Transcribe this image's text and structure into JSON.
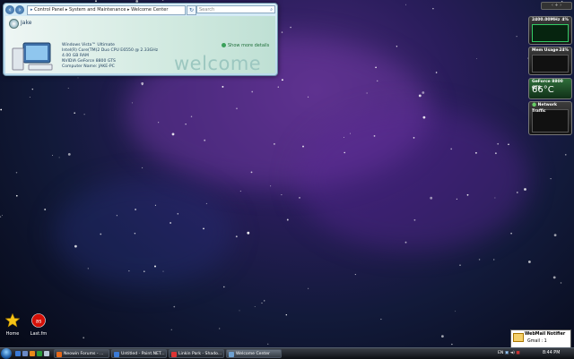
{
  "window": {
    "breadcrumb": [
      "Control Panel",
      "System and Maintenance",
      "Welcome Center"
    ],
    "search_placeholder": "Search",
    "user_name": "Jake",
    "system_info": [
      "Windows Vista™ Ultimate",
      "Intel(R) Core(TM)2 Duo CPU     E6550  @ 2.33GHz",
      "4.00 GB RAM",
      "NVIDIA GeForce 8800 GTS",
      "Computer Name: JAKE-PC"
    ],
    "show_more_label": "Show more details",
    "welcome_word": "welcome"
  },
  "gadgets": {
    "cpu_title": "2400.00MHz",
    "cpu_percent": "4%",
    "mem_title": "Mem Usage",
    "mem_percent": "24%",
    "gpu_title": "GeForce 8800 GTS",
    "gpu_temp": "66°C",
    "net_title": "Network Traffic"
  },
  "desktop_icons": [
    {
      "label": "Home",
      "icon": "star-icon"
    },
    {
      "label": "Last.fm",
      "icon": "lastfm-icon"
    }
  ],
  "notifier": {
    "title": "WebMail Notifier",
    "count": "Gmail : 1"
  },
  "taskbar": {
    "tasks": [
      {
        "label": "Neowin Forums - ...",
        "icon_color": "#e66a1a"
      },
      {
        "label": "Untitled - Paint.NET...",
        "icon_color": "#3a7ad6"
      },
      {
        "label": "Linkin Park - Shado...",
        "icon_color": "#d33"
      },
      {
        "label": "Welcome Center",
        "icon_color": "#6fa1d1"
      }
    ],
    "clock": "8:44 PM"
  },
  "colors": {
    "accent": "#2d5f96",
    "graph_green": "#3c6"
  }
}
